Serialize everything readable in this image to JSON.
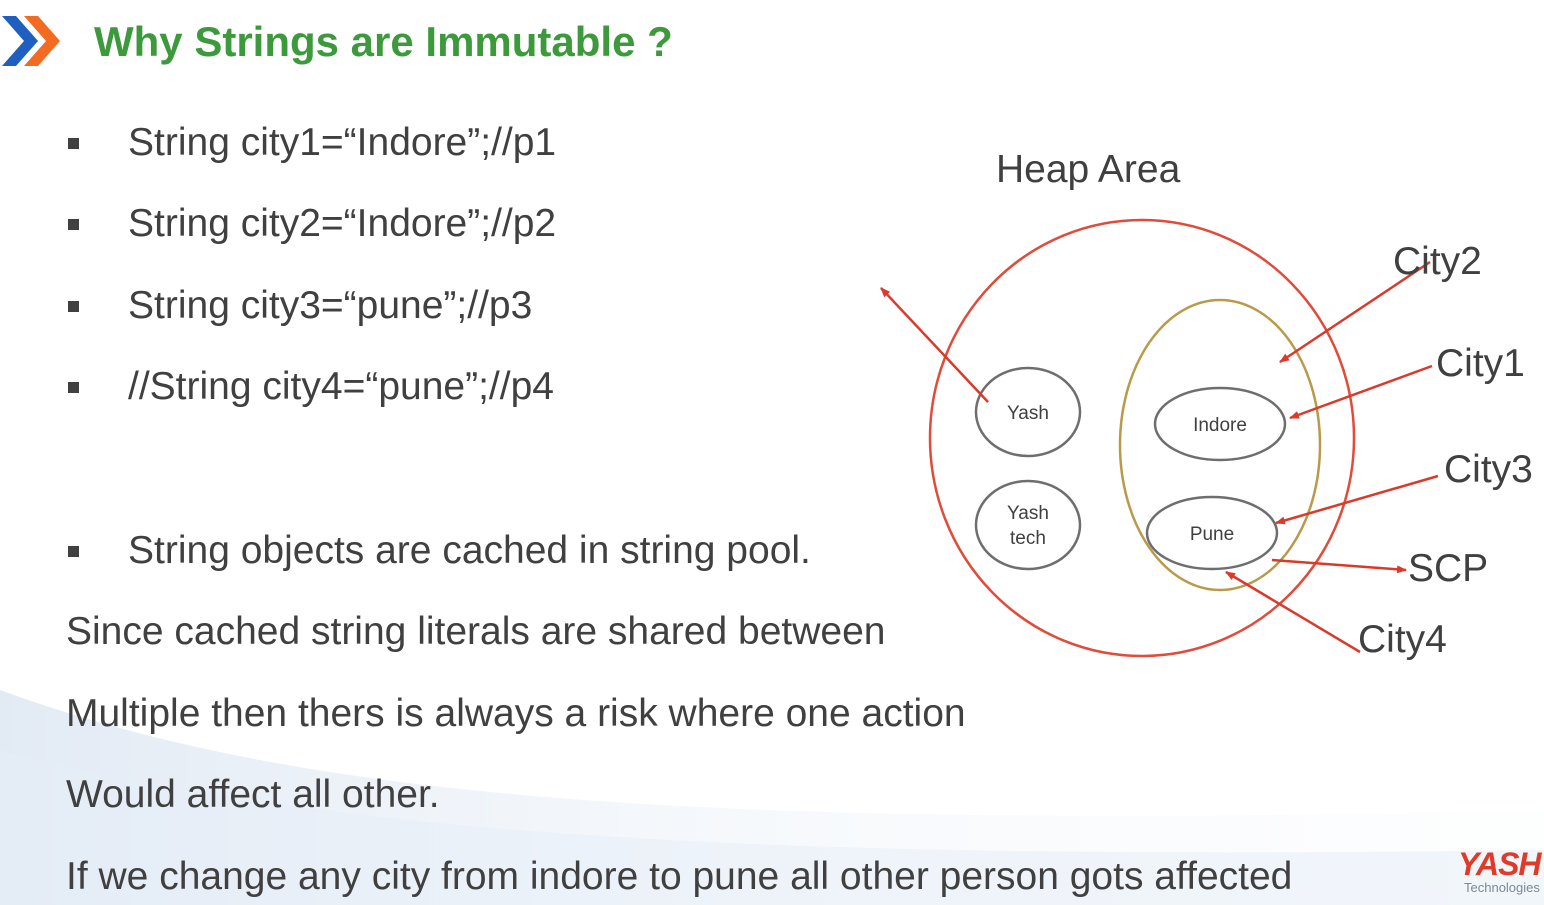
{
  "slide": {
    "title": "Why Strings are Immutable ?",
    "bullets": [
      "String city1=“Indore”;//p1",
      "String city2=“Indore”;//p2",
      "String city3=“pune”;//p3",
      "//String city4=“pune”;//p4"
    ],
    "cache_bullet": "String objects are cached in string pool.",
    "paragraphs": [
      "Since cached string literals are shared between",
      "Multiple then thers is always a risk where one action",
      "Would affect all other.",
      "If we change any city from indore to pune all other person gots affected"
    ]
  },
  "diagram": {
    "heap_label": "Heap Area",
    "nodes": {
      "yash": "Yash",
      "yash_tech_line1": "Yash",
      "yash_tech_line2": "tech",
      "indore": "Indore",
      "pune": "Pune"
    },
    "labels": {
      "city2": "City2",
      "city1": "City1",
      "city3": "City3",
      "scp": "SCP",
      "city4": "City4"
    },
    "colors": {
      "heap_circle": "#e04b3a",
      "scp_oval": "#b89a4a",
      "arrow": "#d93a2a",
      "node_border": "#6e6e6e"
    }
  },
  "logo": {
    "brand": "YASH",
    "sub": "Technologies"
  },
  "theme": {
    "title_color": "#3c9a3c",
    "chevron_blue": "#1f5fbf",
    "chevron_orange": "#f26b21"
  }
}
